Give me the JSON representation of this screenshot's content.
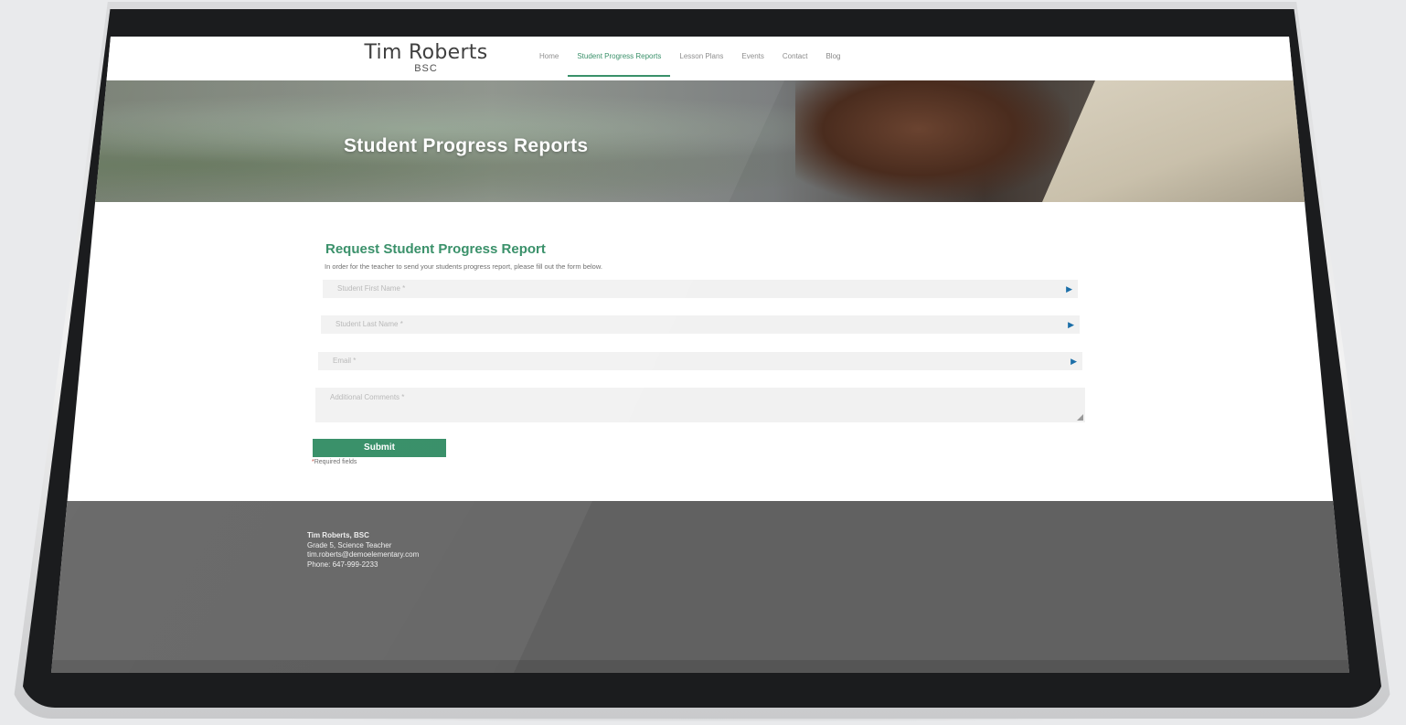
{
  "site": {
    "logo_name": "Tim Roberts",
    "logo_sub": "BSC"
  },
  "nav": {
    "items": [
      {
        "label": "Home",
        "active": false
      },
      {
        "label": "Student Progress Reports",
        "active": true
      },
      {
        "label": "Lesson Plans",
        "active": false
      },
      {
        "label": "Events",
        "active": false
      },
      {
        "label": "Contact",
        "active": false
      },
      {
        "label": "Blog",
        "active": false
      }
    ]
  },
  "hero": {
    "title": "Student Progress Reports"
  },
  "form": {
    "title": "Request Student Progress Report",
    "intro": "In order for the teacher to send your students progress report, please fill out the form below.",
    "fields": {
      "first_name": "Student First Name *",
      "last_name": "Student Last Name *",
      "email": "Email *",
      "comments": "Additional Comments *"
    },
    "submit_label": "Submit",
    "required_star": "*",
    "required_note": "Required fields"
  },
  "footer": {
    "name": "Tim Roberts, BSC",
    "role": "Grade 5, Science Teacher",
    "email": "tim.roberts@demoelementary.com",
    "phone": "Phone: 647-999-2233"
  },
  "colors": {
    "accent": "#2e8a61",
    "footer": "#616161",
    "field_bg": "#f1f1f1"
  }
}
